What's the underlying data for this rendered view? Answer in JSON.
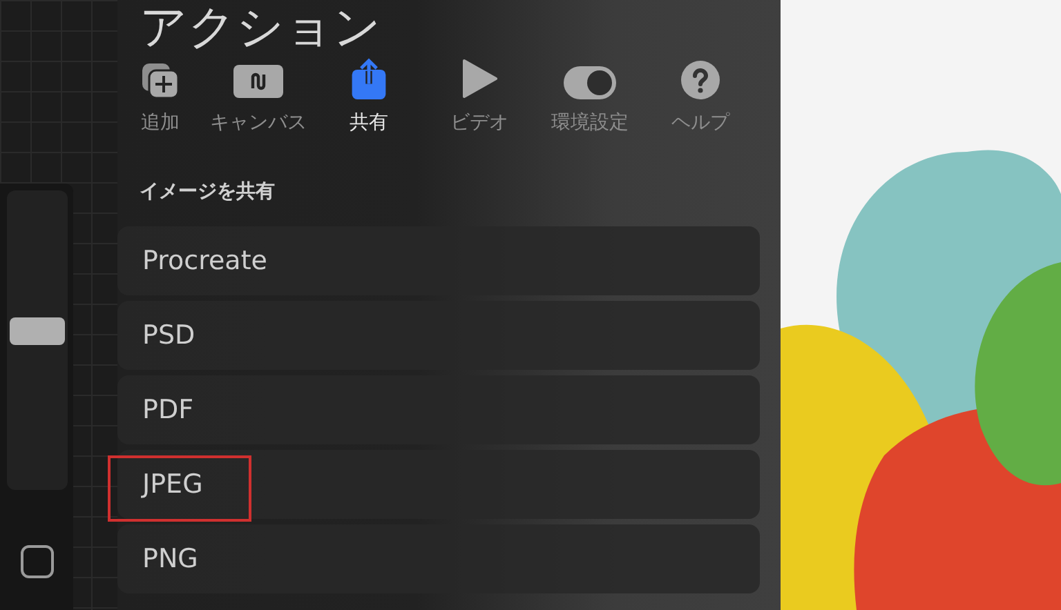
{
  "panel": {
    "title": "アクション",
    "tabs": [
      {
        "label": "追加",
        "selected": false
      },
      {
        "label": "キャンバス",
        "selected": false
      },
      {
        "label": "共有",
        "selected": true
      },
      {
        "label": "ビデオ",
        "selected": false
      },
      {
        "label": "環境設定",
        "selected": false
      },
      {
        "label": "ヘルプ",
        "selected": false
      }
    ],
    "section_title": "イメージを共有",
    "items": [
      {
        "label": "Procreate",
        "highlighted": false
      },
      {
        "label": "PSD",
        "highlighted": false
      },
      {
        "label": "PDF",
        "highlighted": false
      },
      {
        "label": "JPEG",
        "highlighted": true
      },
      {
        "label": "PNG",
        "highlighted": false
      }
    ]
  },
  "sidebar": {
    "brush_size": {
      "level": 0.53
    }
  }
}
